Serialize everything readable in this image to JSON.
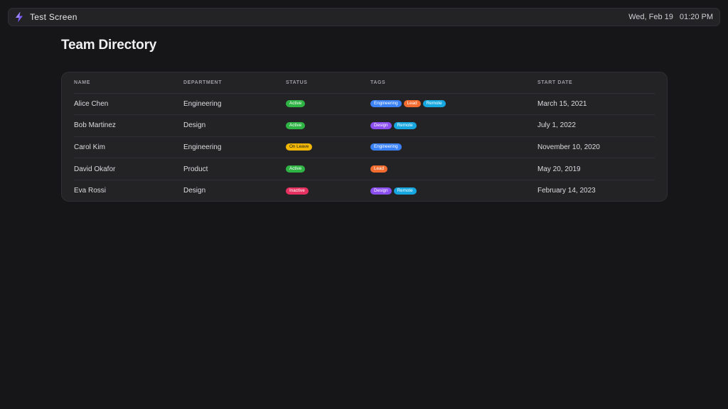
{
  "app": {
    "title": "Test Screen",
    "date": "Wed, Feb 19",
    "time": "01:20 PM",
    "logo_icon": "lightning-logo-icon",
    "logo_color": "#7b5cf5"
  },
  "page": {
    "title": "Team Directory"
  },
  "table": {
    "columns": [
      "NAME",
      "DEPARTMENT",
      "STATUS",
      "TAGS",
      "START DATE"
    ],
    "rows": [
      {
        "name": "Alice Chen",
        "department": "Engineering",
        "status": "Active",
        "tags": [
          "Engineering",
          "Lead",
          "Remote"
        ],
        "start_date": "March 15, 2021"
      },
      {
        "name": "Bob Martinez",
        "department": "Design",
        "status": "Active",
        "tags": [
          "Design",
          "Remote"
        ],
        "start_date": "July 1, 2022"
      },
      {
        "name": "Carol Kim",
        "department": "Engineering",
        "status": "On Leave",
        "tags": [
          "Engineering"
        ],
        "start_date": "November 10, 2020"
      },
      {
        "name": "David Okafor",
        "department": "Product",
        "status": "Active",
        "tags": [
          "Lead"
        ],
        "start_date": "May 20, 2019"
      },
      {
        "name": "Eva Rossi",
        "department": "Design",
        "status": "Inactive",
        "tags": [
          "Design",
          "Remote"
        ],
        "start_date": "February 14, 2023"
      }
    ]
  },
  "colors": {
    "status": {
      "Active": "#2fb344",
      "On Leave": "#f2b705",
      "Inactive": "#e5315f"
    },
    "status_text": {
      "Active": "#ffffff",
      "On Leave": "#1d1d1d",
      "Inactive": "#ffffff"
    },
    "tags": {
      "Engineering": "#3b82f6",
      "Lead": "#f26b2f",
      "Remote": "#17a7e0",
      "Design": "#8b4ff0"
    }
  }
}
